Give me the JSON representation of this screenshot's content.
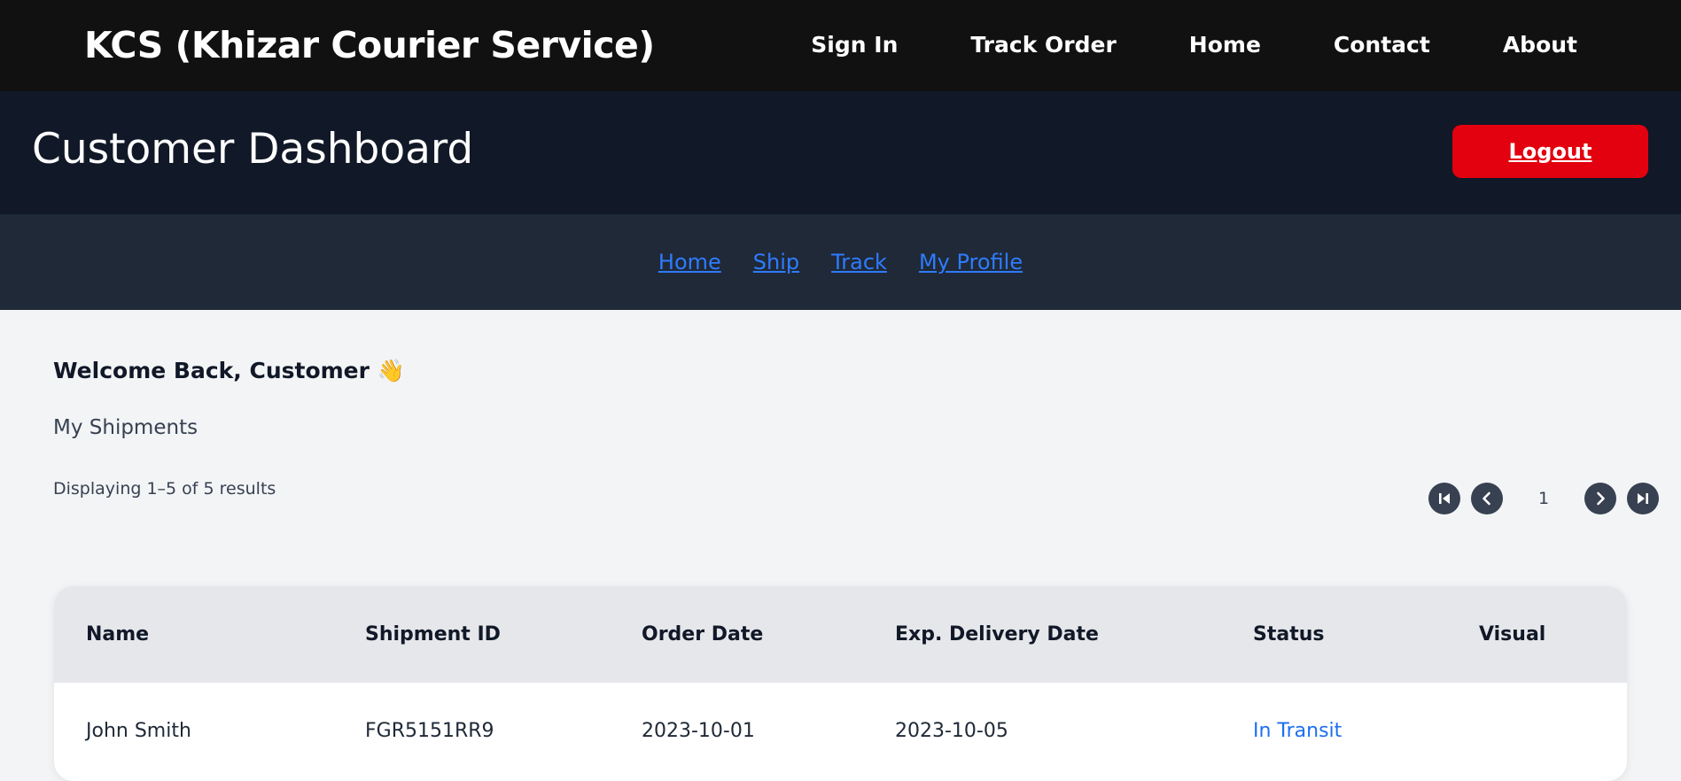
{
  "brand": "KCS (Khizar Courier Service)",
  "top_nav": [
    "Sign In",
    "Track Order",
    "Home",
    "Contact",
    "About"
  ],
  "dashboard": {
    "title": "Customer Dashboard",
    "logout_label": "Logout"
  },
  "sub_nav": [
    "Home",
    "Ship",
    "Track",
    "My Profile"
  ],
  "main": {
    "welcome": "Welcome Back, Customer",
    "welcome_emoji": "👋",
    "section_title": "My Shipments",
    "results_text": "Displaying 1–5 of 5 results",
    "current_page": "1"
  },
  "table": {
    "columns": [
      "Name",
      "Shipment ID",
      "Order Date",
      "Exp. Delivery Date",
      "Status",
      "Visual"
    ],
    "rows": [
      {
        "name": "John Smith",
        "shipment_id": "FGR5151RR9",
        "order_date": "2023-10-01",
        "exp_delivery": "2023-10-05",
        "status": "In Transit",
        "visual": ""
      }
    ]
  },
  "colors": {
    "topbar": "#111111",
    "header": "#111827",
    "subnav": "#1f2937",
    "logout": "#e3000f",
    "link": "#2f7bff",
    "status": "#1d6ff2"
  },
  "icons": [
    "first-page-icon",
    "previous-page-icon",
    "next-page-icon",
    "last-page-icon"
  ]
}
